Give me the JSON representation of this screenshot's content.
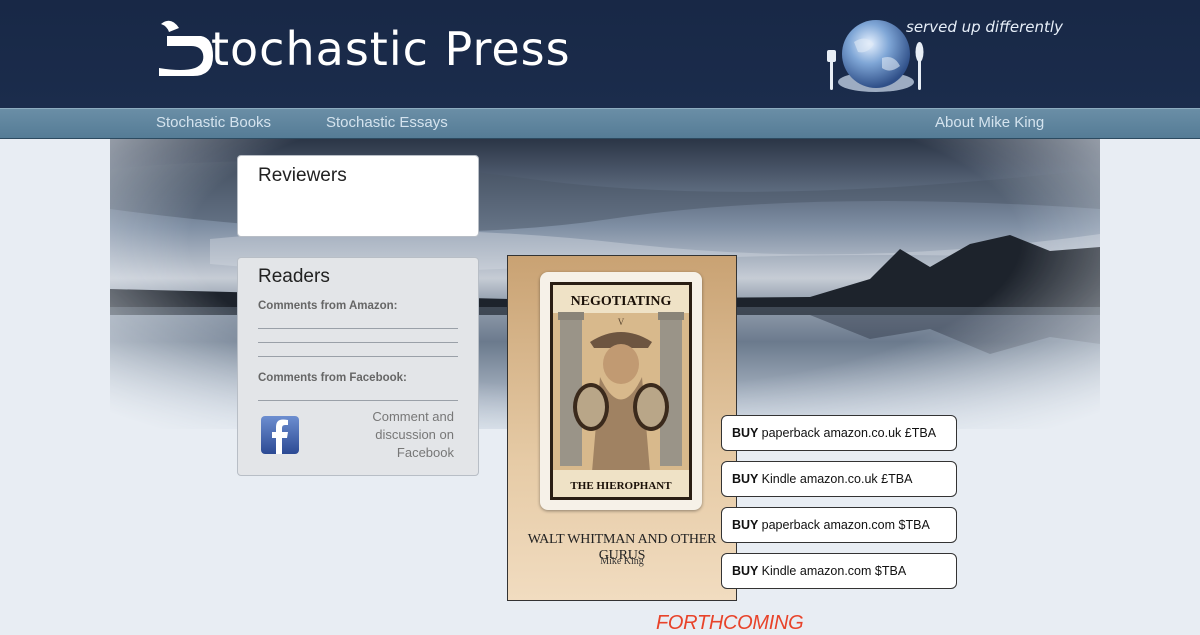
{
  "header": {
    "logo_text": "tochastic Press",
    "tagline": "served up differently"
  },
  "nav": {
    "items": [
      {
        "label": "Stochastic Books"
      },
      {
        "label": "Stochastic Essays"
      },
      {
        "label": "About Mike King"
      }
    ]
  },
  "reviewers": {
    "title": "Reviewers"
  },
  "readers": {
    "title": "Readers",
    "amazon_heading": "Comments from Amazon:",
    "facebook_heading": "Comments from Facebook:",
    "facebook_text": "Comment and discussion on Facebook"
  },
  "book": {
    "title_top": "NEGOTIATING",
    "title_bottom": "THE HIEROPHANT",
    "roman": "V",
    "subtitle": "WALT WHITMAN AND OTHER GURUS",
    "author": "Mike King"
  },
  "buy_buttons": [
    {
      "prefix": "BUY",
      "label": "paperback amazon.co.uk £TBA"
    },
    {
      "prefix": "BUY",
      "label": "Kindle amazon.co.uk £TBA"
    },
    {
      "prefix": "BUY",
      "label": "paperback amazon.com $TBA"
    },
    {
      "prefix": "BUY",
      "label": "Kindle amazon.com $TBA"
    }
  ],
  "status": "FORTHCOMING",
  "colors": {
    "header_bg": "#1b2c4c",
    "nav_bg": "#5f8aa3",
    "accent_red": "#e8432a"
  }
}
